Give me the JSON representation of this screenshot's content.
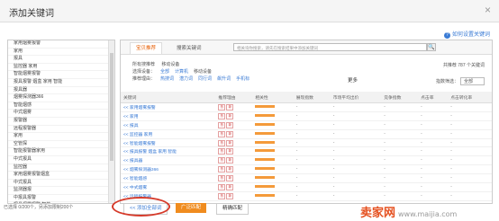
{
  "dialog": {
    "title": "添加关键词",
    "close": "×"
  },
  "help": "如何设置关键词",
  "left_list": [
    "家用烟雾报警",
    "家用",
    "报具",
    "监控器 家用",
    "智能烟雾报警",
    "报具报警 烟盒 家用 智能",
    "报具器",
    "烟雾探测器366",
    "智能烟感",
    "中式烟雾",
    "报警器",
    "远程报警器",
    "家用",
    "空管探",
    "智能报警器家用",
    "中式报具",
    "监控器",
    "家用烟雾报警烟盒",
    "中式报具",
    "监测器报",
    "中报具报警",
    "报具烟雾报警 智能",
    "28%报具"
  ],
  "left_footer": "已选择 0/200个，另添加限制200个",
  "tabs": [
    "宝贝推荐",
    "搜索关键词"
  ],
  "search_placeholder": "相关询你搜索，请先在搜索结果中添加关键词",
  "search_btn": "🔍",
  "filters": {
    "cat_label": "所有搜推荐",
    "cat_value": "移动设备",
    "dev_label": "选择设备：",
    "dev_opts": [
      "全部",
      "计算机",
      "移动设备"
    ],
    "rec_label": "推荐理由：",
    "rec_opts": [
      "热搜词",
      "潜力词",
      "同行词",
      "飙升词",
      "手机标"
    ]
  },
  "more": "更多",
  "count": "共推荐 787 个关键词",
  "sort_label": "指数筛选：",
  "sort_value": "全部",
  "columns": [
    "关键词",
    "推荐理由",
    "相关性",
    "展现指数",
    "市场平均出价",
    "竞争指数",
    "点击率",
    "点击转化率"
  ],
  "rows": [
    {
      "kw": "<< 家用烟雾报警",
      "r": [
        "热",
        "新"
      ]
    },
    {
      "kw": "<< 家用",
      "r": [
        "热",
        "新"
      ]
    },
    {
      "kw": "<< 报具",
      "r": [
        "热",
        "新"
      ]
    },
    {
      "kw": "<< 监控器 家用",
      "r": [
        "热",
        "新"
      ]
    },
    {
      "kw": "<< 智能烟雾报警",
      "r": [
        "热",
        "新"
      ]
    },
    {
      "kw": "<< 报具报警 烟盒 家用 智能",
      "r": [
        "热",
        "新"
      ]
    },
    {
      "kw": "<< 报具器",
      "r": [
        "热",
        "新"
      ]
    },
    {
      "kw": "<< 烟雾探测器366",
      "r": [
        "热",
        "新"
      ]
    },
    {
      "kw": "<< 智能烟感",
      "r": [
        "热",
        "新"
      ]
    },
    {
      "kw": "<< 中式烟雾",
      "r": [
        "热",
        "新"
      ]
    },
    {
      "kw": "<< 远程报警器",
      "r": [
        "热",
        "新"
      ]
    }
  ],
  "dash": "-",
  "btn_add": "<< 添加全部词",
  "btn_or": "广泛匹配",
  "btn_exact": "精确匹配",
  "watermark": {
    "brand": "卖家网",
    "url": "www.maijia.com"
  }
}
